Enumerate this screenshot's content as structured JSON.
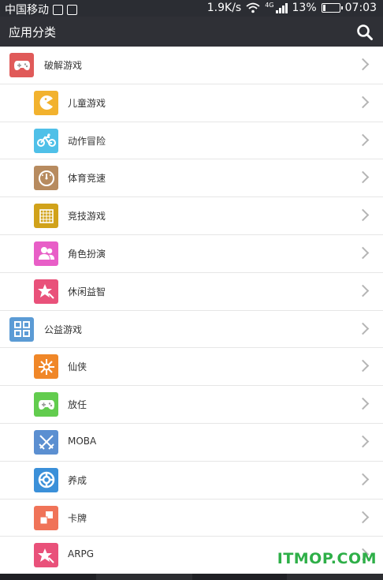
{
  "status_bar": {
    "carrier": "中国移动",
    "speed": "1.9K/s",
    "network": "4G",
    "battery": "13%",
    "time": "07:03",
    "icons": [
      "notification-icon",
      "image-icon",
      "wifi-icon",
      "signal-icon",
      "battery-icon"
    ]
  },
  "header": {
    "title": "应用分类",
    "search_icon": "search-icon"
  },
  "list": [
    {
      "type": "category",
      "label": "破解游戏",
      "icon": "gamepad-icon",
      "color": "#e05a59"
    },
    {
      "type": "sub",
      "label": "儿童游戏",
      "icon": "pacman-icon",
      "color": "#f2b22e"
    },
    {
      "type": "sub",
      "label": "动作冒险",
      "icon": "bicycle-icon",
      "color": "#4fc0e8"
    },
    {
      "type": "sub",
      "label": "体育竞速",
      "icon": "speedometer-icon",
      "color": "#b78b5f"
    },
    {
      "type": "sub",
      "label": "竞技游戏",
      "icon": "grid-icon",
      "color": "#d1a21a"
    },
    {
      "type": "sub",
      "label": "角色扮演",
      "icon": "people-icon",
      "color": "#e85ec7"
    },
    {
      "type": "sub",
      "label": "休闲益智",
      "icon": "star-icon",
      "color": "#e9517a"
    },
    {
      "type": "category",
      "label": "公益游戏",
      "icon": "apps-grid-icon",
      "color": "#5b9bd5"
    },
    {
      "type": "sub",
      "label": "仙侠",
      "icon": "sparkle-icon",
      "color": "#f08728"
    },
    {
      "type": "sub",
      "label": "放任",
      "icon": "gamepad-icon",
      "color": "#62cc4e"
    },
    {
      "type": "sub",
      "label": "MOBA",
      "icon": "crossed-swords-icon",
      "color": "#5b8fd1"
    },
    {
      "type": "sub",
      "label": "养成",
      "icon": "lifebuoy-icon",
      "color": "#3b90d9"
    },
    {
      "type": "sub",
      "label": "卡牌",
      "icon": "cards-icon",
      "color": "#f07358"
    },
    {
      "type": "sub",
      "label": "ARPG",
      "icon": "star-icon",
      "color": "#e9517a"
    }
  ],
  "watermark": "ITMOP.COM"
}
